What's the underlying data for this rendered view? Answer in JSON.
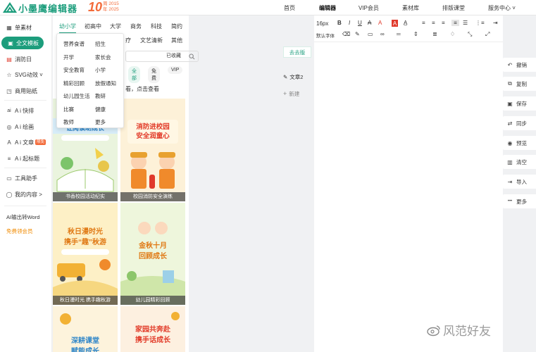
{
  "brand": {
    "logo_text": "小墨鹰编辑器",
    "anniversary_number": "10",
    "anniversary_line1": "周 2015",
    "anniversary_line2": "年 2025"
  },
  "nav": [
    {
      "label": "首页",
      "active": false
    },
    {
      "label": "编辑器",
      "active": true
    },
    {
      "label": "VIP会员",
      "active": false
    },
    {
      "label": "素材库",
      "active": false
    },
    {
      "label": "排版课堂",
      "active": false
    },
    {
      "label": "服务中心 ˅",
      "active": false
    }
  ],
  "rail": [
    {
      "label": "单素材",
      "icon": "grid-icon",
      "glyph": "▦"
    },
    {
      "label": "全文模板",
      "icon": "layout-icon",
      "glyph": "▣",
      "active": true
    },
    {
      "label": "消防日",
      "icon": "calendar-icon",
      "glyph": "▤"
    },
    {
      "label": "SVG动效 ˅",
      "icon": "star-icon",
      "glyph": "☆"
    },
    {
      "label": "商用贴纸",
      "icon": "sticker-icon",
      "glyph": "◳"
    },
    {
      "label": "A i 快排",
      "icon": "ai-icon",
      "glyph": "ai"
    },
    {
      "label": "A i 绘画",
      "icon": "palette-icon",
      "glyph": "◎"
    },
    {
      "label": "A i 文章",
      "icon": "ai-article-icon",
      "glyph": "A",
      "badge": "限免"
    },
    {
      "label": "A i 起标题",
      "icon": "title-icon",
      "glyph": "≡"
    },
    {
      "label": "工具助手",
      "icon": "tools-icon",
      "glyph": "▭"
    },
    {
      "label": "我的内容 ˃",
      "icon": "user-icon",
      "glyph": "◯"
    }
  ],
  "rail_links": {
    "word": "AI输出转Word",
    "vip": "免费领会员"
  },
  "categories": [
    "幼小学",
    "初高中",
    "大学",
    "商务",
    "科技",
    "简约"
  ],
  "subcategories": [
    "疗",
    "文艺清新",
    "其他"
  ],
  "search": {
    "placeholder": ""
  },
  "collected": "已收藏",
  "filters": [
    "全部",
    "免费",
    "VIP"
  ],
  "hint": "看，点击查看",
  "dropdown": [
    [
      "营养食谱",
      "招生"
    ],
    [
      "开学",
      "家长会"
    ],
    [
      "安全教育",
      "小学"
    ],
    [
      "精彩回顾",
      "放假通知"
    ],
    [
      "幼儿园生活",
      "教研"
    ],
    [
      "比赛",
      "健康"
    ],
    [
      "教师",
      "更多"
    ]
  ],
  "cards": [
    {
      "caption": "书香校园活动纪实",
      "title": "",
      "sub": ""
    },
    {
      "caption": "校园消防安全演练",
      "title": "消防进校园",
      "title2": "安全润童心"
    },
    {
      "caption": "秋日漫时光 携手趣秋游",
      "title": "秋日漫时光",
      "title2": "携手“趣”秋游"
    },
    {
      "caption": "幼儿园精彩回顾",
      "title": "金秋十月",
      "title2": "回顾成长"
    },
    {
      "caption": "",
      "title": "深耕课堂",
      "title2": "赋能成长"
    },
    {
      "caption": "",
      "title": "家园共奔赴",
      "title2": "携手话成长"
    }
  ],
  "editor": {
    "font_size": "16px",
    "font_family": "默认字体",
    "chip_active": "去去版",
    "doc_tab": "文章2",
    "new_label": "新建"
  },
  "actions": [
    {
      "label": "撤销",
      "icon": "undo-icon",
      "glyph": "↶"
    },
    {
      "label": "复制",
      "icon": "copy-icon",
      "glyph": "⧉"
    },
    {
      "label": "保存",
      "icon": "save-icon",
      "glyph": "▣"
    },
    {
      "label": "同步",
      "icon": "sync-icon",
      "glyph": "⇄"
    },
    {
      "label": "预览",
      "icon": "eye-icon",
      "glyph": "◉"
    },
    {
      "label": "清空",
      "icon": "trash-icon",
      "glyph": "▥"
    },
    {
      "label": "导入",
      "icon": "import-icon",
      "glyph": "⇥"
    },
    {
      "label": "更多",
      "icon": "more-icon",
      "glyph": "•••"
    }
  ],
  "watermark": "风范好友",
  "colors": {
    "brand": "#1c9d7c",
    "accent": "#f36b3a"
  }
}
